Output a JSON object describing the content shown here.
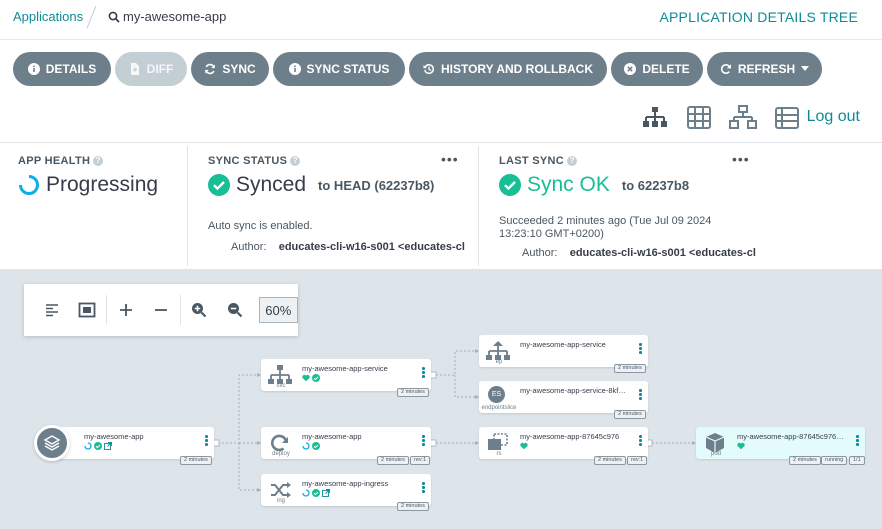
{
  "breadcrumb": {
    "root": "Applications",
    "current": "my-awesome-app"
  },
  "page_title": "APPLICATION DETAILS TREE",
  "toolbar": {
    "details": "DETAILS",
    "diff": "DIFF",
    "sync": "SYNC",
    "sync_status": "SYNC STATUS",
    "history": "HISTORY AND ROLLBACK",
    "delete": "DELETE",
    "refresh": "REFRESH"
  },
  "logout": "Log out",
  "app_health": {
    "title": "APP HEALTH",
    "status": "Progressing"
  },
  "sync_status": {
    "title": "SYNC STATUS",
    "status": "Synced",
    "target": "to HEAD (62237b8)",
    "auto": "Auto sync is enabled.",
    "author_label": "Author:",
    "author": "educates-cli-w16-s001 <educates-cl"
  },
  "last_sync": {
    "title": "LAST SYNC",
    "status": "Sync OK",
    "target": "to 62237b8",
    "time_line1": "Succeeded 2 minutes ago (Tue Jul 09 2024",
    "time_line2": "13:23:10 GMT+0200)",
    "author_label": "Author:",
    "author": "educates-cli-w16-s001 <educates-cl"
  },
  "zoom": {
    "value": "60%"
  },
  "nodes": {
    "app": {
      "name": "my-awesome-app",
      "age": "2 minutes"
    },
    "svc": {
      "name": "my-awesome-app-service",
      "kind": "svc",
      "age": "2 minutes"
    },
    "deploy": {
      "name": "my-awesome-app",
      "kind": "deploy",
      "age": "2 minutes",
      "rev": "rev:1"
    },
    "ing": {
      "name": "my-awesome-app-ingress",
      "kind": "ing",
      "age": "2 minutes"
    },
    "ep": {
      "name": "my-awesome-app-service",
      "kind": "ep",
      "age": "2 minutes"
    },
    "es": {
      "name": "my-awesome-app-service-8kf…",
      "kind": "endpointslice",
      "badge": "ES",
      "age": "2 minutes"
    },
    "rs": {
      "name": "my-awesome-app-87645c976",
      "kind": "rs",
      "age": "2 minutes",
      "rev": "rev:1"
    },
    "pod": {
      "name": "my-awesome-app-87645c976…",
      "kind": "pod",
      "age": "2 minutes",
      "state": "running",
      "ready": "1/1"
    }
  },
  "colors": {
    "accent": "#0f8a96",
    "healthy": "#18be94",
    "progressing": "#0dadea",
    "button": "#6d7f8b"
  }
}
